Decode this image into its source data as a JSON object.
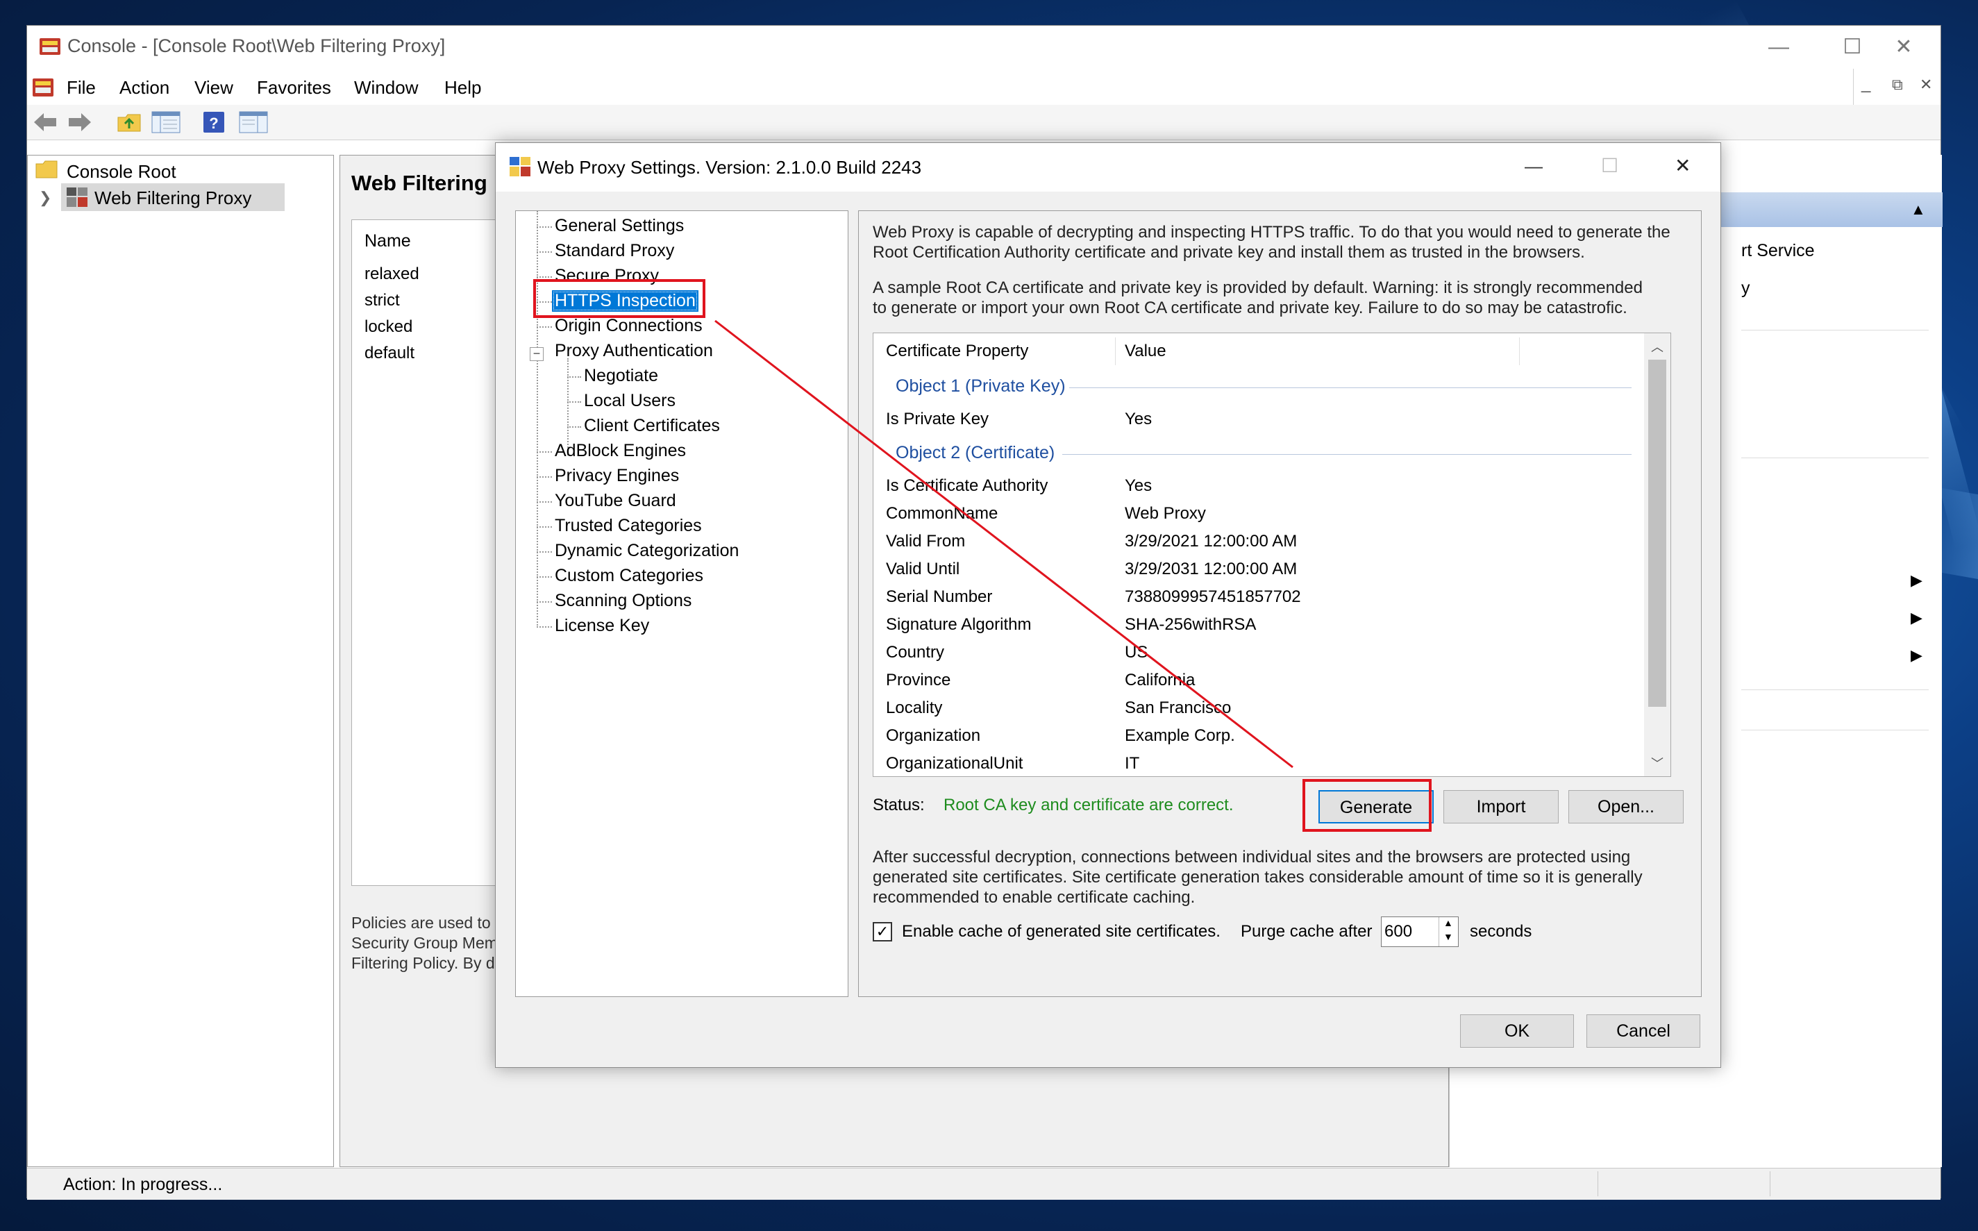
{
  "mmc": {
    "title": "Console - [Console Root\\Web Filtering Proxy]",
    "caption_min": "—",
    "caption_max": "☐",
    "caption_close": "✕",
    "menus": [
      "File",
      "Action",
      "View",
      "Favorites",
      "Window",
      "Help"
    ],
    "inner_min": "_",
    "inner_restore": "⧉",
    "inner_close": "✕",
    "tree": {
      "root": "Console Root",
      "child": "Web Filtering Proxy"
    },
    "center": {
      "heading": "Web Filtering",
      "column_name": "Name",
      "rows": [
        "relaxed",
        "strict",
        "locked",
        "default"
      ],
      "description": [
        "Policies are used to",
        "Security Group Mem",
        "Filtering Policy. By d"
      ]
    },
    "right": {
      "item1": "rt Service",
      "item2": "y"
    },
    "status": "Action:  In progress..."
  },
  "dialog": {
    "title": "Web Proxy Settings. Version: 2.1.0.0 Build 2243",
    "caption_min": "—",
    "caption_max": "☐",
    "caption_close": "✕",
    "nav": {
      "general": "General Settings",
      "standard": "Standard Proxy",
      "secure": "Secure Proxy",
      "https": "HTTPS Inspection",
      "origin": "Origin Connections",
      "proxy_auth": "Proxy Authentication",
      "negotiate": "Negotiate",
      "local_users": "Local Users",
      "client_certs": "Client Certificates",
      "adblock": "AdBlock Engines",
      "privacy": "Privacy Engines",
      "youtube": "YouTube Guard",
      "trusted": "Trusted Categories",
      "dynamic": "Dynamic Categorization",
      "custom": "Custom Categories",
      "scanning": "Scanning Options",
      "license": "License Key"
    },
    "intro1": [
      "Web Proxy is capable of decrypting and inspecting HTTPS traffic. To do that you would need to generate the",
      "Root Certification Authority certificate and private key and install them as trusted in the browsers."
    ],
    "intro2": [
      "A sample Root CA certificate and private key is provided by default. Warning: it is strongly recommended",
      "to generate or import your own Root CA certificate and private key. Failure to do so may be catastrofic."
    ],
    "cert_table": {
      "col_property": "Certificate Property",
      "col_value": "Value",
      "group1": "Object 1 (Private Key)",
      "group1_rows": [
        {
          "k": "Is Private Key",
          "v": "Yes"
        }
      ],
      "group2": "Object 2 (Certificate)",
      "group2_rows": [
        {
          "k": "Is Certificate Authority",
          "v": "Yes"
        },
        {
          "k": "CommonName",
          "v": "Web Proxy"
        },
        {
          "k": "Valid From",
          "v": "3/29/2021 12:00:00 AM"
        },
        {
          "k": "Valid Until",
          "v": "3/29/2031 12:00:00 AM"
        },
        {
          "k": "Serial Number",
          "v": "7388099957451857702"
        },
        {
          "k": "Signature Algorithm",
          "v": "SHA-256withRSA"
        },
        {
          "k": "Country",
          "v": "US"
        },
        {
          "k": "Province",
          "v": "California"
        },
        {
          "k": "Locality",
          "v": "San Francisco"
        },
        {
          "k": "Organization",
          "v": "Example Corp."
        },
        {
          "k": "OrganizationalUnit",
          "v": "IT"
        }
      ]
    },
    "status_label": "Status:",
    "status_value": "Root CA key and certificate are correct.",
    "buttons": {
      "generate": "Generate",
      "import": "Import",
      "open": "Open...",
      "ok": "OK",
      "cancel": "Cancel"
    },
    "after": [
      "After successful decryption, connections between individual sites and the browsers are protected using",
      "generated site certificates. Site certificate generation takes considerable amount of time so it is generally",
      "recommended to enable certificate caching."
    ],
    "cache_checkbox_label": "Enable cache of generated site certificates.",
    "cache_checked": true,
    "purge_label": "Purge cache after",
    "purge_value": "600",
    "seconds_label": "seconds"
  },
  "colors": {
    "selection": "#0078d7",
    "annotation": "#e0141e",
    "status_ok": "#1e8c1e",
    "group_header": "#1f4fa0"
  }
}
